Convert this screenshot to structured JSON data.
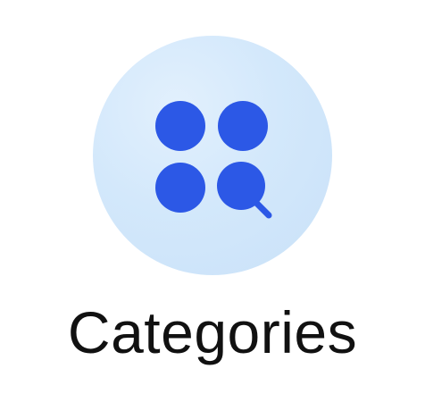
{
  "app_tile": {
    "label": "Categories",
    "icon": "categories-search-icon",
    "colors": {
      "circle_background": "#d3e8fb",
      "glyph": "#2c58e6",
      "label_text": "#111111"
    }
  }
}
